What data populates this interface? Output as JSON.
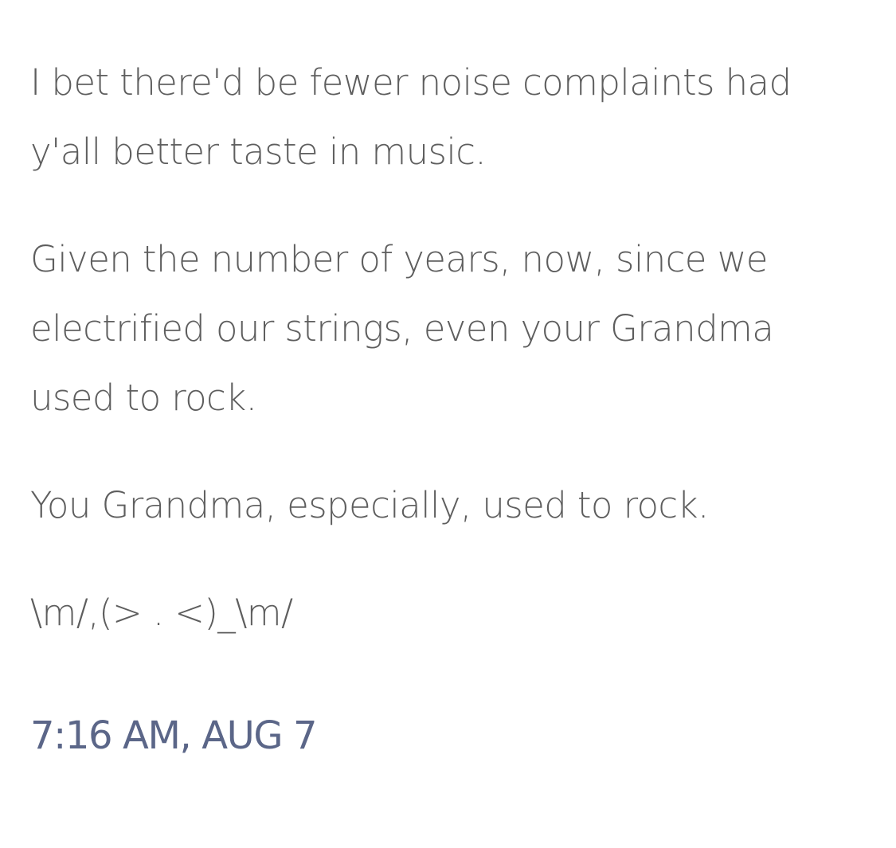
{
  "post": {
    "paragraphs": [
      "I bet there'd be fewer noise complaints had y'all better taste in music.",
      "Given the number of years, now, since we electrified our strings, even your Grandma used to rock.",
      "You Grandma, especially, used to rock.",
      "\\m/,(> . <)_\\m/"
    ],
    "timestamp": "7:16 AM, AUG 7"
  },
  "colors": {
    "body_text": "#5e5e5e",
    "timestamp": "#5b6688",
    "background": "#ffffff"
  }
}
